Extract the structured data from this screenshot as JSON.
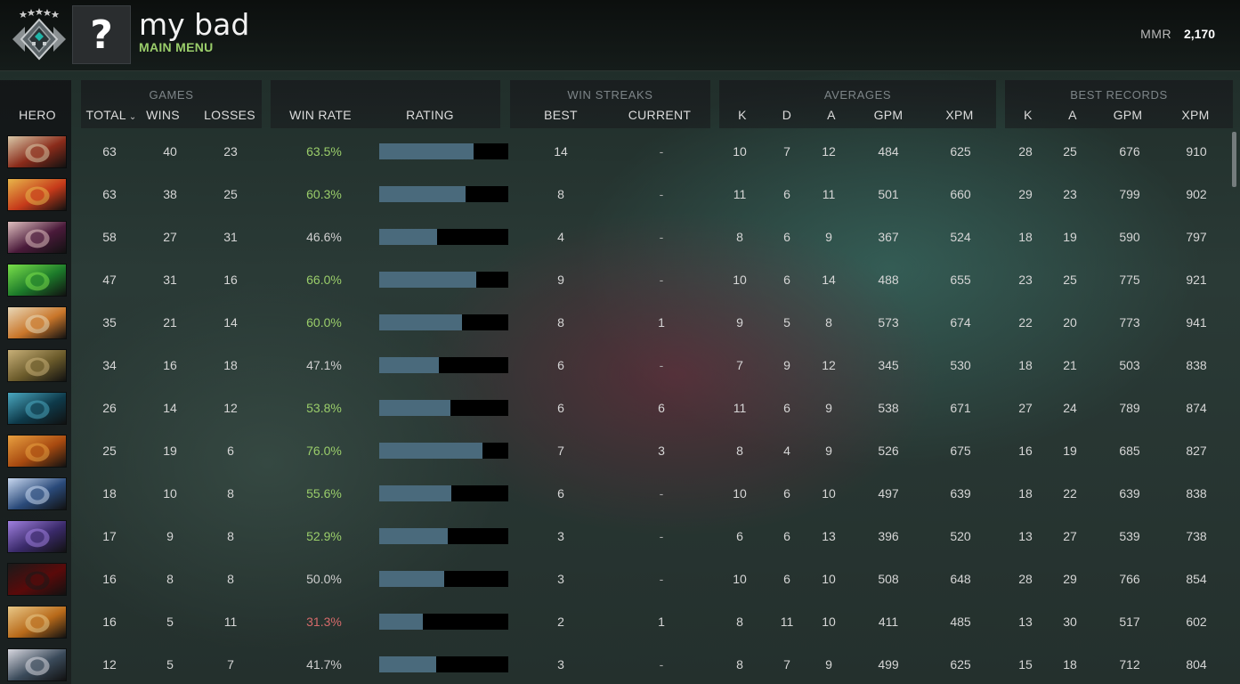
{
  "header": {
    "username": "my bad",
    "subtitle": "MAIN MENU",
    "avatar_glyph": "?",
    "mmr_label": "MMR",
    "mmr_value": "2,170",
    "rank_icon": "rank-medal-icon"
  },
  "table": {
    "hero_header": "HERO",
    "groups": {
      "games": "GAMES",
      "win_streaks": "WIN STREAKS",
      "averages": "AVERAGES",
      "best_records": "BEST RECORDS"
    },
    "headers": {
      "total": "TOTAL",
      "wins": "WINS",
      "losses": "LOSSES",
      "win_rate": "WIN RATE",
      "rating": "RATING",
      "best": "BEST",
      "current": "CURRENT",
      "avg_k": "K",
      "avg_d": "D",
      "avg_a": "A",
      "avg_gpm": "GPM",
      "avg_xpm": "XPM",
      "rec_k": "K",
      "rec_a": "A",
      "rec_gpm": "GPM",
      "rec_xpm": "XPM"
    },
    "rows": [
      {
        "hero_colors": [
          "#8a2b1a",
          "#d9c8a8"
        ],
        "total": "63",
        "wins": "40",
        "losses": "23",
        "win_rate": "63.5%",
        "win_rate_color": "#9acd6a",
        "rating": 0.73,
        "best": "14",
        "current": "-",
        "k": "10",
        "d": "7",
        "a": "12",
        "gpm": "484",
        "xpm": "625",
        "rk": "28",
        "ra": "25",
        "rgpm": "676",
        "rxpm": "910"
      },
      {
        "hero_colors": [
          "#c63a1a",
          "#e8b64a"
        ],
        "total": "63",
        "wins": "38",
        "losses": "25",
        "win_rate": "60.3%",
        "win_rate_color": "#9acd6a",
        "rating": 0.67,
        "best": "8",
        "current": "-",
        "k": "11",
        "d": "6",
        "a": "11",
        "gpm": "501",
        "xpm": "660",
        "rk": "29",
        "ra": "23",
        "rgpm": "799",
        "rxpm": "902"
      },
      {
        "hero_colors": [
          "#4a1a3a",
          "#e0c0c0"
        ],
        "total": "58",
        "wins": "27",
        "losses": "31",
        "win_rate": "46.6%",
        "win_rate_color": "#cfcfcf",
        "rating": 0.45,
        "best": "4",
        "current": "-",
        "k": "8",
        "d": "6",
        "a": "9",
        "gpm": "367",
        "xpm": "524",
        "rk": "18",
        "ra": "19",
        "rgpm": "590",
        "rxpm": "797"
      },
      {
        "hero_colors": [
          "#1c7a2a",
          "#7ae04a"
        ],
        "total": "47",
        "wins": "31",
        "losses": "16",
        "win_rate": "66.0%",
        "win_rate_color": "#9acd6a",
        "rating": 0.75,
        "best": "9",
        "current": "-",
        "k": "10",
        "d": "6",
        "a": "14",
        "gpm": "488",
        "xpm": "655",
        "rk": "23",
        "ra": "25",
        "rgpm": "775",
        "rxpm": "921"
      },
      {
        "hero_colors": [
          "#c9762a",
          "#e8d8b8"
        ],
        "total": "35",
        "wins": "21",
        "losses": "14",
        "win_rate": "60.0%",
        "win_rate_color": "#9acd6a",
        "rating": 0.64,
        "best": "8",
        "current": "1",
        "k": "9",
        "d": "5",
        "a": "8",
        "gpm": "573",
        "xpm": "674",
        "rk": "22",
        "ra": "20",
        "rgpm": "773",
        "rxpm": "941"
      },
      {
        "hero_colors": [
          "#6a5a2a",
          "#c8b078"
        ],
        "total": "34",
        "wins": "16",
        "losses": "18",
        "win_rate": "47.1%",
        "win_rate_color": "#cfcfcf",
        "rating": 0.46,
        "best": "6",
        "current": "-",
        "k": "7",
        "d": "9",
        "a": "12",
        "gpm": "345",
        "xpm": "530",
        "rk": "18",
        "ra": "21",
        "rgpm": "503",
        "rxpm": "838"
      },
      {
        "hero_colors": [
          "#0e3a4a",
          "#4aa8c0"
        ],
        "total": "26",
        "wins": "14",
        "losses": "12",
        "win_rate": "53.8%",
        "win_rate_color": "#9acd6a",
        "rating": 0.55,
        "best": "6",
        "current": "6",
        "k": "11",
        "d": "6",
        "a": "9",
        "gpm": "538",
        "xpm": "671",
        "rk": "27",
        "ra": "24",
        "rgpm": "789",
        "rxpm": "874"
      },
      {
        "hero_colors": [
          "#a84a10",
          "#e8a040"
        ],
        "total": "25",
        "wins": "19",
        "losses": "6",
        "win_rate": "76.0%",
        "win_rate_color": "#9acd6a",
        "rating": 0.8,
        "best": "7",
        "current": "3",
        "k": "8",
        "d": "4",
        "a": "9",
        "gpm": "526",
        "xpm": "675",
        "rk": "16",
        "ra": "19",
        "rgpm": "685",
        "rxpm": "827"
      },
      {
        "hero_colors": [
          "#2a4a7a",
          "#c8d8f0"
        ],
        "total": "18",
        "wins": "10",
        "losses": "8",
        "win_rate": "55.6%",
        "win_rate_color": "#9acd6a",
        "rating": 0.56,
        "best": "6",
        "current": "-",
        "k": "10",
        "d": "6",
        "a": "10",
        "gpm": "497",
        "xpm": "639",
        "rk": "18",
        "ra": "22",
        "rgpm": "639",
        "rxpm": "838"
      },
      {
        "hero_colors": [
          "#3a2a6a",
          "#a080e0"
        ],
        "total": "17",
        "wins": "9",
        "losses": "8",
        "win_rate": "52.9%",
        "win_rate_color": "#9acd6a",
        "rating": 0.53,
        "best": "3",
        "current": "-",
        "k": "6",
        "d": "6",
        "a": "13",
        "gpm": "396",
        "xpm": "520",
        "rk": "13",
        "ra": "27",
        "rgpm": "539",
        "rxpm": "738"
      },
      {
        "hero_colors": [
          "#5a0a0a",
          "#1a1a1a"
        ],
        "total": "16",
        "wins": "8",
        "losses": "8",
        "win_rate": "50.0%",
        "win_rate_color": "#cfcfcf",
        "rating": 0.5,
        "best": "3",
        "current": "-",
        "k": "10",
        "d": "6",
        "a": "10",
        "gpm": "508",
        "xpm": "648",
        "rk": "28",
        "ra": "29",
        "rgpm": "766",
        "rxpm": "854"
      },
      {
        "hero_colors": [
          "#b86a1a",
          "#e8c888"
        ],
        "total": "16",
        "wins": "5",
        "losses": "11",
        "win_rate": "31.3%",
        "win_rate_color": "#d46a6a",
        "rating": 0.34,
        "best": "2",
        "current": "1",
        "k": "8",
        "d": "11",
        "a": "10",
        "gpm": "411",
        "xpm": "485",
        "rk": "13",
        "ra": "30",
        "rgpm": "517",
        "rxpm": "602"
      },
      {
        "hero_colors": [
          "#3a4a5a",
          "#d8d8e0"
        ],
        "total": "12",
        "wins": "5",
        "losses": "7",
        "win_rate": "41.7%",
        "win_rate_color": "#cfcfcf",
        "rating": 0.44,
        "best": "3",
        "current": "-",
        "k": "8",
        "d": "7",
        "a": "9",
        "gpm": "499",
        "xpm": "625",
        "rk": "15",
        "ra": "18",
        "rgpm": "712",
        "rxpm": "804"
      }
    ]
  }
}
